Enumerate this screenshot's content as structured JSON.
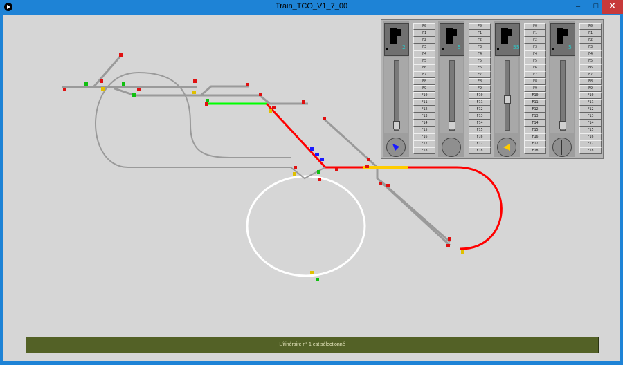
{
  "window": {
    "title": "Train_TCO_V1_7_00",
    "minimize_glyph": "–",
    "maximize_glyph": "□",
    "close_glyph": "✕"
  },
  "colors": {
    "route_red": "#ff0000",
    "route_green": "#00ff00",
    "track_gray": "#9a9a9a",
    "track_white": "#ffffff",
    "train_blue": "#1a1aff",
    "train_yellow": "#ffcc00"
  },
  "controller": {
    "locos": [
      {
        "digit": "2",
        "direction_color": "#1a1aff",
        "direction_icon": "blue-triangle"
      },
      {
        "digit": "5",
        "direction_color": "",
        "direction_icon": "none"
      },
      {
        "digit": "55",
        "direction_color": "#ffcc00",
        "direction_icon": "yellow-triangle"
      },
      {
        "digit": "5",
        "direction_color": "",
        "direction_icon": "none"
      }
    ],
    "function_keys": [
      "F0",
      "F1",
      "F2",
      "F3",
      "F4",
      "F5",
      "F6",
      "F7",
      "F8",
      "F9",
      "F10",
      "F11",
      "F12",
      "F13",
      "F14",
      "F15",
      "F16",
      "F17",
      "F18",
      "F19",
      "F20",
      "F21",
      "F22",
      "F23",
      "F24",
      "F25",
      "F26",
      "F27",
      "F28"
    ]
  },
  "status": {
    "message": "L'itinéraire n° 1 est sélectionné"
  }
}
